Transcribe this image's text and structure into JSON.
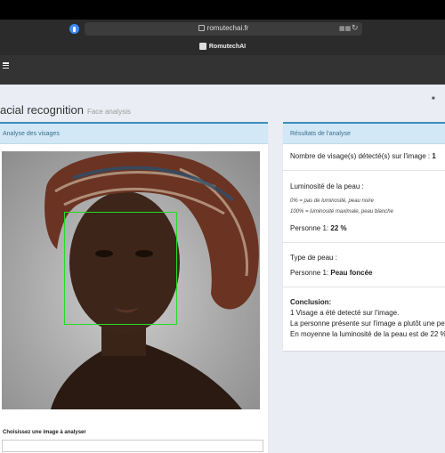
{
  "browser": {
    "url": "romutechai.fr",
    "site_name": "RomutechAI",
    "icons": [
      "shield-icon",
      "lock-icon",
      "translate-icon",
      "reload-icon"
    ]
  },
  "header": {
    "menu_icon": "hamburger-menu-icon"
  },
  "page": {
    "title": "acial recognition",
    "subtitle": "Face analysis",
    "breadcrumb_icon": "dashboard-icon"
  },
  "analysis_card": {
    "title": "Analyse des visages",
    "choose_label": "Choisissez une image à analyser"
  },
  "results_card": {
    "title": "Résultats de l'analyse",
    "faces_label": "Nombre de visage(s) détecté(s) sur l'image :",
    "faces_count": "1",
    "luminosity_title": "Luminosité de la peau :",
    "luminosity_scale_0": "0% = pas de luminosité, peau noire",
    "luminosity_scale_100": "100% = luminosité maximale, peau blanche",
    "person_label": "Personne 1:",
    "person_luminosity": "22 %",
    "skin_type_title": "Type de peau :",
    "person_skin_type": "Peau foncée",
    "conclusion_title": "Conclusion:",
    "conclusion_1": "1 Visage a été detecté sur l'image.",
    "conclusion_2": "La personne présente sur l'image a plutôt une peau",
    "conclusion_3": "En moyenne la luminosité de la peau est de 22 %"
  },
  "colors": {
    "accent": "#3c8dbc",
    "card_header": "#d2e8f6",
    "face_box": "#22dd22",
    "page_background": "#eaeef4",
    "app_header": "#333333"
  }
}
